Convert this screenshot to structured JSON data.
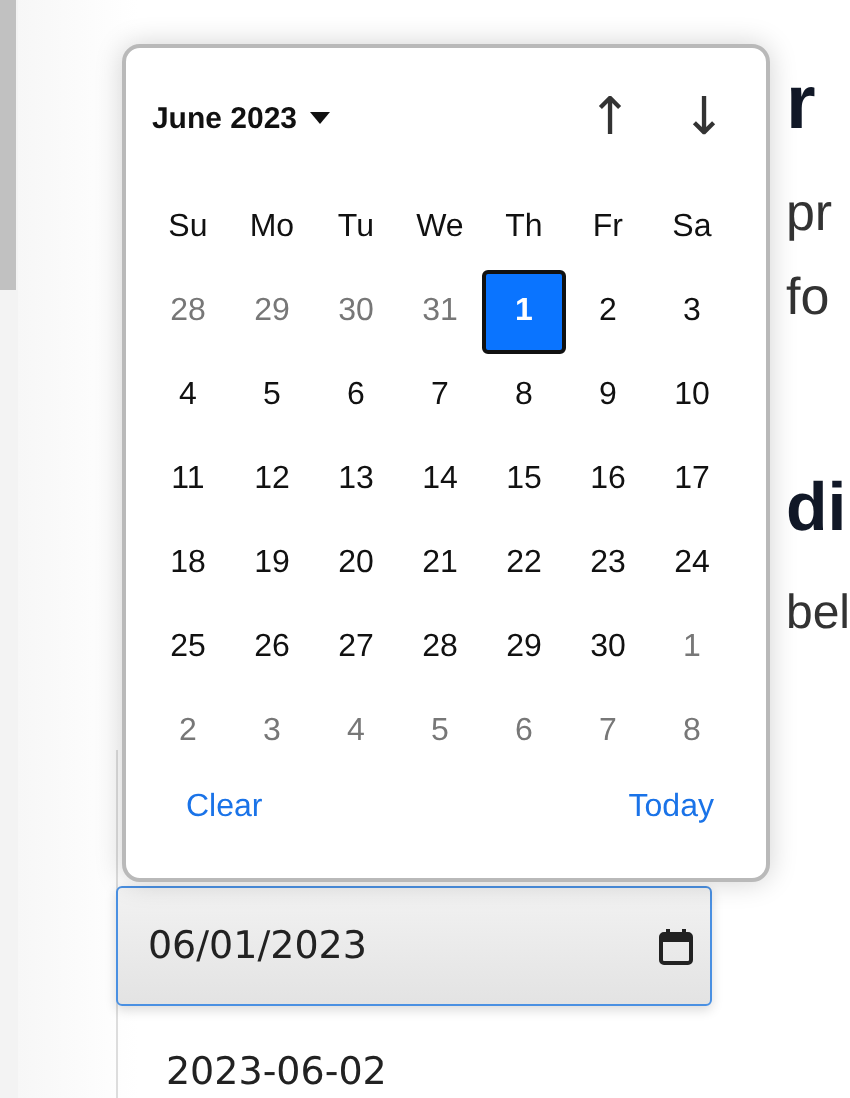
{
  "page": {
    "heading_fragment": "r",
    "intro_fragment": "pr",
    "field_suffix_fragment": "fo",
    "section_heading_fragment": "di",
    "section_text_fragment": "bel"
  },
  "date_field": {
    "value": "06/01/2023"
  },
  "table_cell": "2023-06-02",
  "calendar": {
    "month_label": "June 2023",
    "up_arrow": "↑",
    "down_arrow": "↓",
    "weekdays": [
      "Su",
      "Mo",
      "Tu",
      "We",
      "Th",
      "Fr",
      "Sa"
    ],
    "weeks": [
      [
        {
          "label": "28",
          "in_month": false,
          "selected": false
        },
        {
          "label": "29",
          "in_month": false,
          "selected": false
        },
        {
          "label": "30",
          "in_month": false,
          "selected": false
        },
        {
          "label": "31",
          "in_month": false,
          "selected": false
        },
        {
          "label": "1",
          "in_month": true,
          "selected": true
        },
        {
          "label": "2",
          "in_month": true,
          "selected": false
        },
        {
          "label": "3",
          "in_month": true,
          "selected": false
        }
      ],
      [
        {
          "label": "4",
          "in_month": true,
          "selected": false
        },
        {
          "label": "5",
          "in_month": true,
          "selected": false
        },
        {
          "label": "6",
          "in_month": true,
          "selected": false
        },
        {
          "label": "7",
          "in_month": true,
          "selected": false
        },
        {
          "label": "8",
          "in_month": true,
          "selected": false
        },
        {
          "label": "9",
          "in_month": true,
          "selected": false
        },
        {
          "label": "10",
          "in_month": true,
          "selected": false
        }
      ],
      [
        {
          "label": "11",
          "in_month": true,
          "selected": false
        },
        {
          "label": "12",
          "in_month": true,
          "selected": false
        },
        {
          "label": "13",
          "in_month": true,
          "selected": false
        },
        {
          "label": "14",
          "in_month": true,
          "selected": false
        },
        {
          "label": "15",
          "in_month": true,
          "selected": false
        },
        {
          "label": "16",
          "in_month": true,
          "selected": false
        },
        {
          "label": "17",
          "in_month": true,
          "selected": false
        }
      ],
      [
        {
          "label": "18",
          "in_month": true,
          "selected": false
        },
        {
          "label": "19",
          "in_month": true,
          "selected": false
        },
        {
          "label": "20",
          "in_month": true,
          "selected": false
        },
        {
          "label": "21",
          "in_month": true,
          "selected": false
        },
        {
          "label": "22",
          "in_month": true,
          "selected": false
        },
        {
          "label": "23",
          "in_month": true,
          "selected": false
        },
        {
          "label": "24",
          "in_month": true,
          "selected": false
        }
      ],
      [
        {
          "label": "25",
          "in_month": true,
          "selected": false
        },
        {
          "label": "26",
          "in_month": true,
          "selected": false
        },
        {
          "label": "27",
          "in_month": true,
          "selected": false
        },
        {
          "label": "28",
          "in_month": true,
          "selected": false
        },
        {
          "label": "29",
          "in_month": true,
          "selected": false
        },
        {
          "label": "30",
          "in_month": true,
          "selected": false
        },
        {
          "label": "1",
          "in_month": false,
          "selected": false
        }
      ],
      [
        {
          "label": "2",
          "in_month": false,
          "selected": false
        },
        {
          "label": "3",
          "in_month": false,
          "selected": false
        },
        {
          "label": "4",
          "in_month": false,
          "selected": false
        },
        {
          "label": "5",
          "in_month": false,
          "selected": false
        },
        {
          "label": "6",
          "in_month": false,
          "selected": false
        },
        {
          "label": "7",
          "in_month": false,
          "selected": false
        },
        {
          "label": "8",
          "in_month": false,
          "selected": false
        }
      ]
    ],
    "footer": [
      "Clear",
      "Today"
    ]
  }
}
